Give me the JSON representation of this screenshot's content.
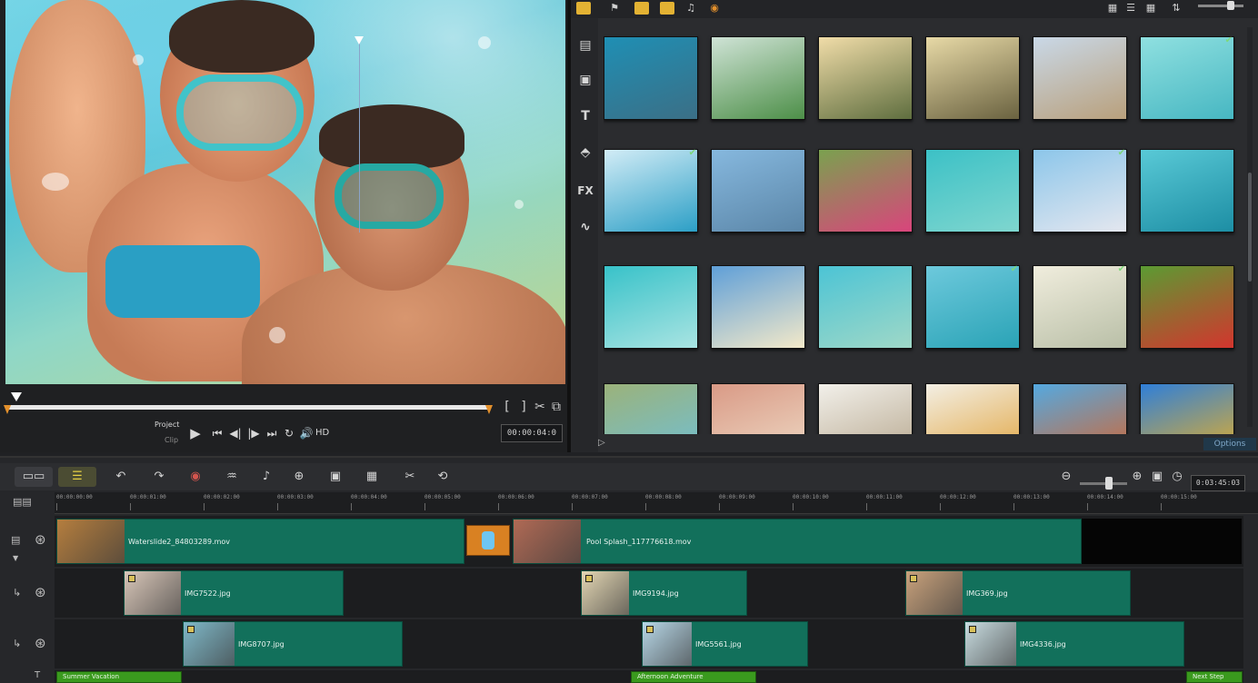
{
  "preview": {
    "mode_project": "Project",
    "mode_clip": "Clip",
    "timecode": "00:00:04:0",
    "hd": "HD",
    "trim_in": "[",
    "trim_out": "]"
  },
  "library": {
    "options": "Options",
    "side_fx": "FX",
    "side_title": "T",
    "thumbnails": [
      {
        "row": 0,
        "col": 0,
        "colors": [
          "#1f8fb4",
          "#3b6f86"
        ],
        "checked": false
      },
      {
        "row": 0,
        "col": 1,
        "colors": [
          "#cfe3d6",
          "#4d8f48"
        ],
        "checked": false
      },
      {
        "row": 0,
        "col": 2,
        "colors": [
          "#f0dca8",
          "#5f6e3f"
        ],
        "checked": false
      },
      {
        "row": 0,
        "col": 3,
        "colors": [
          "#e7d9a6",
          "#6a6240"
        ],
        "checked": false
      },
      {
        "row": 0,
        "col": 4,
        "colors": [
          "#c9d8e7",
          "#b9a07c"
        ],
        "checked": false
      },
      {
        "row": 0,
        "col": 5,
        "colors": [
          "#8fe0e0",
          "#47b7c2"
        ],
        "checked": true
      },
      {
        "row": 1,
        "col": 0,
        "colors": [
          "#d2ecf6",
          "#2c9fc6"
        ],
        "checked": true
      },
      {
        "row": 1,
        "col": 1,
        "colors": [
          "#86b8de",
          "#5b86a8"
        ],
        "checked": false
      },
      {
        "row": 1,
        "col": 2,
        "colors": [
          "#7aa14f",
          "#d9457c"
        ],
        "checked": false
      },
      {
        "row": 1,
        "col": 3,
        "colors": [
          "#3cc1c6",
          "#7fd6cf"
        ],
        "checked": false
      },
      {
        "row": 1,
        "col": 4,
        "colors": [
          "#8cc6ea",
          "#e4e7ef"
        ],
        "checked": true
      },
      {
        "row": 1,
        "col": 5,
        "colors": [
          "#59c9d6",
          "#1d8ea4"
        ],
        "checked": false
      },
      {
        "row": 2,
        "col": 0,
        "colors": [
          "#38c2c9",
          "#a9e4e2"
        ],
        "checked": false
      },
      {
        "row": 2,
        "col": 1,
        "colors": [
          "#5f9fd8",
          "#f3e9c9"
        ],
        "checked": false
      },
      {
        "row": 2,
        "col": 2,
        "colors": [
          "#4cc4d5",
          "#9fd8c7"
        ],
        "checked": false
      },
      {
        "row": 2,
        "col": 3,
        "colors": [
          "#6dc9dc",
          "#2aa3b6"
        ],
        "checked": true
      },
      {
        "row": 2,
        "col": 4,
        "colors": [
          "#f0eddd",
          "#b9bfa7"
        ],
        "checked": true
      },
      {
        "row": 2,
        "col": 5,
        "colors": [
          "#5b9b33",
          "#d3352e"
        ],
        "checked": false
      },
      {
        "row": 3,
        "col": 0,
        "colors": [
          "#9bb27a",
          "#6fc0d8"
        ],
        "checked": false
      },
      {
        "row": 3,
        "col": 1,
        "colors": [
          "#d99a86",
          "#efdcc7"
        ],
        "checked": false
      },
      {
        "row": 3,
        "col": 2,
        "colors": [
          "#f2f0ea",
          "#b4a48a"
        ],
        "checked": false
      },
      {
        "row": 3,
        "col": 3,
        "colors": [
          "#f3efe4",
          "#e0a23a"
        ],
        "checked": false
      },
      {
        "row": 3,
        "col": 4,
        "colors": [
          "#54a9e0",
          "#d8632b"
        ],
        "checked": false
      },
      {
        "row": 3,
        "col": 5,
        "colors": [
          "#2f7fd8",
          "#f0b21f"
        ],
        "checked": false
      }
    ]
  },
  "timeline": {
    "timecode": "0:03:45:03",
    "ruler": [
      "00:00:00:00",
      "00:00:01:00",
      "00:00:02:00",
      "00:00:03:00",
      "00:00:04:00",
      "00:00:05:00",
      "00:00:06:00",
      "00:00:07:00",
      "00:00:08:00",
      "00:00:09:00",
      "00:00:10:00",
      "00:00:11:00",
      "00:00:12:00",
      "00:00:13:00",
      "00:00:14:00",
      "00:00:15:00"
    ],
    "video_clips": [
      {
        "label": "Waterslide2_84803289.mov",
        "thumb": "#b57e3e"
      },
      {
        "label": "Pool Splash_117776618.mov",
        "thumb": "#b06a55"
      }
    ],
    "overlay1": [
      {
        "label": "IMG7522.jpg",
        "thumb": "#d8c6b8"
      },
      {
        "label": "IMG9194.jpg",
        "thumb": "#e3d6b3"
      },
      {
        "label": "IMG369.jpg",
        "thumb": "#c9a27c"
      }
    ],
    "overlay2": [
      {
        "label": "IMG8707.jpg",
        "thumb": "#7fb8c8"
      },
      {
        "label": "IMG5561.jpg",
        "thumb": "#b7d7e7"
      },
      {
        "label": "IMG4336.jpg",
        "thumb": "#c8dce0"
      }
    ],
    "titles": [
      {
        "label": "Summer Vacation"
      },
      {
        "label": "Afternoon Adventure"
      },
      {
        "label": "Next Step"
      }
    ]
  },
  "colors": {
    "clip": "#12705b",
    "title_clip": "#3a9a1e",
    "transition": "#d98122",
    "accent": "#e3b233"
  }
}
